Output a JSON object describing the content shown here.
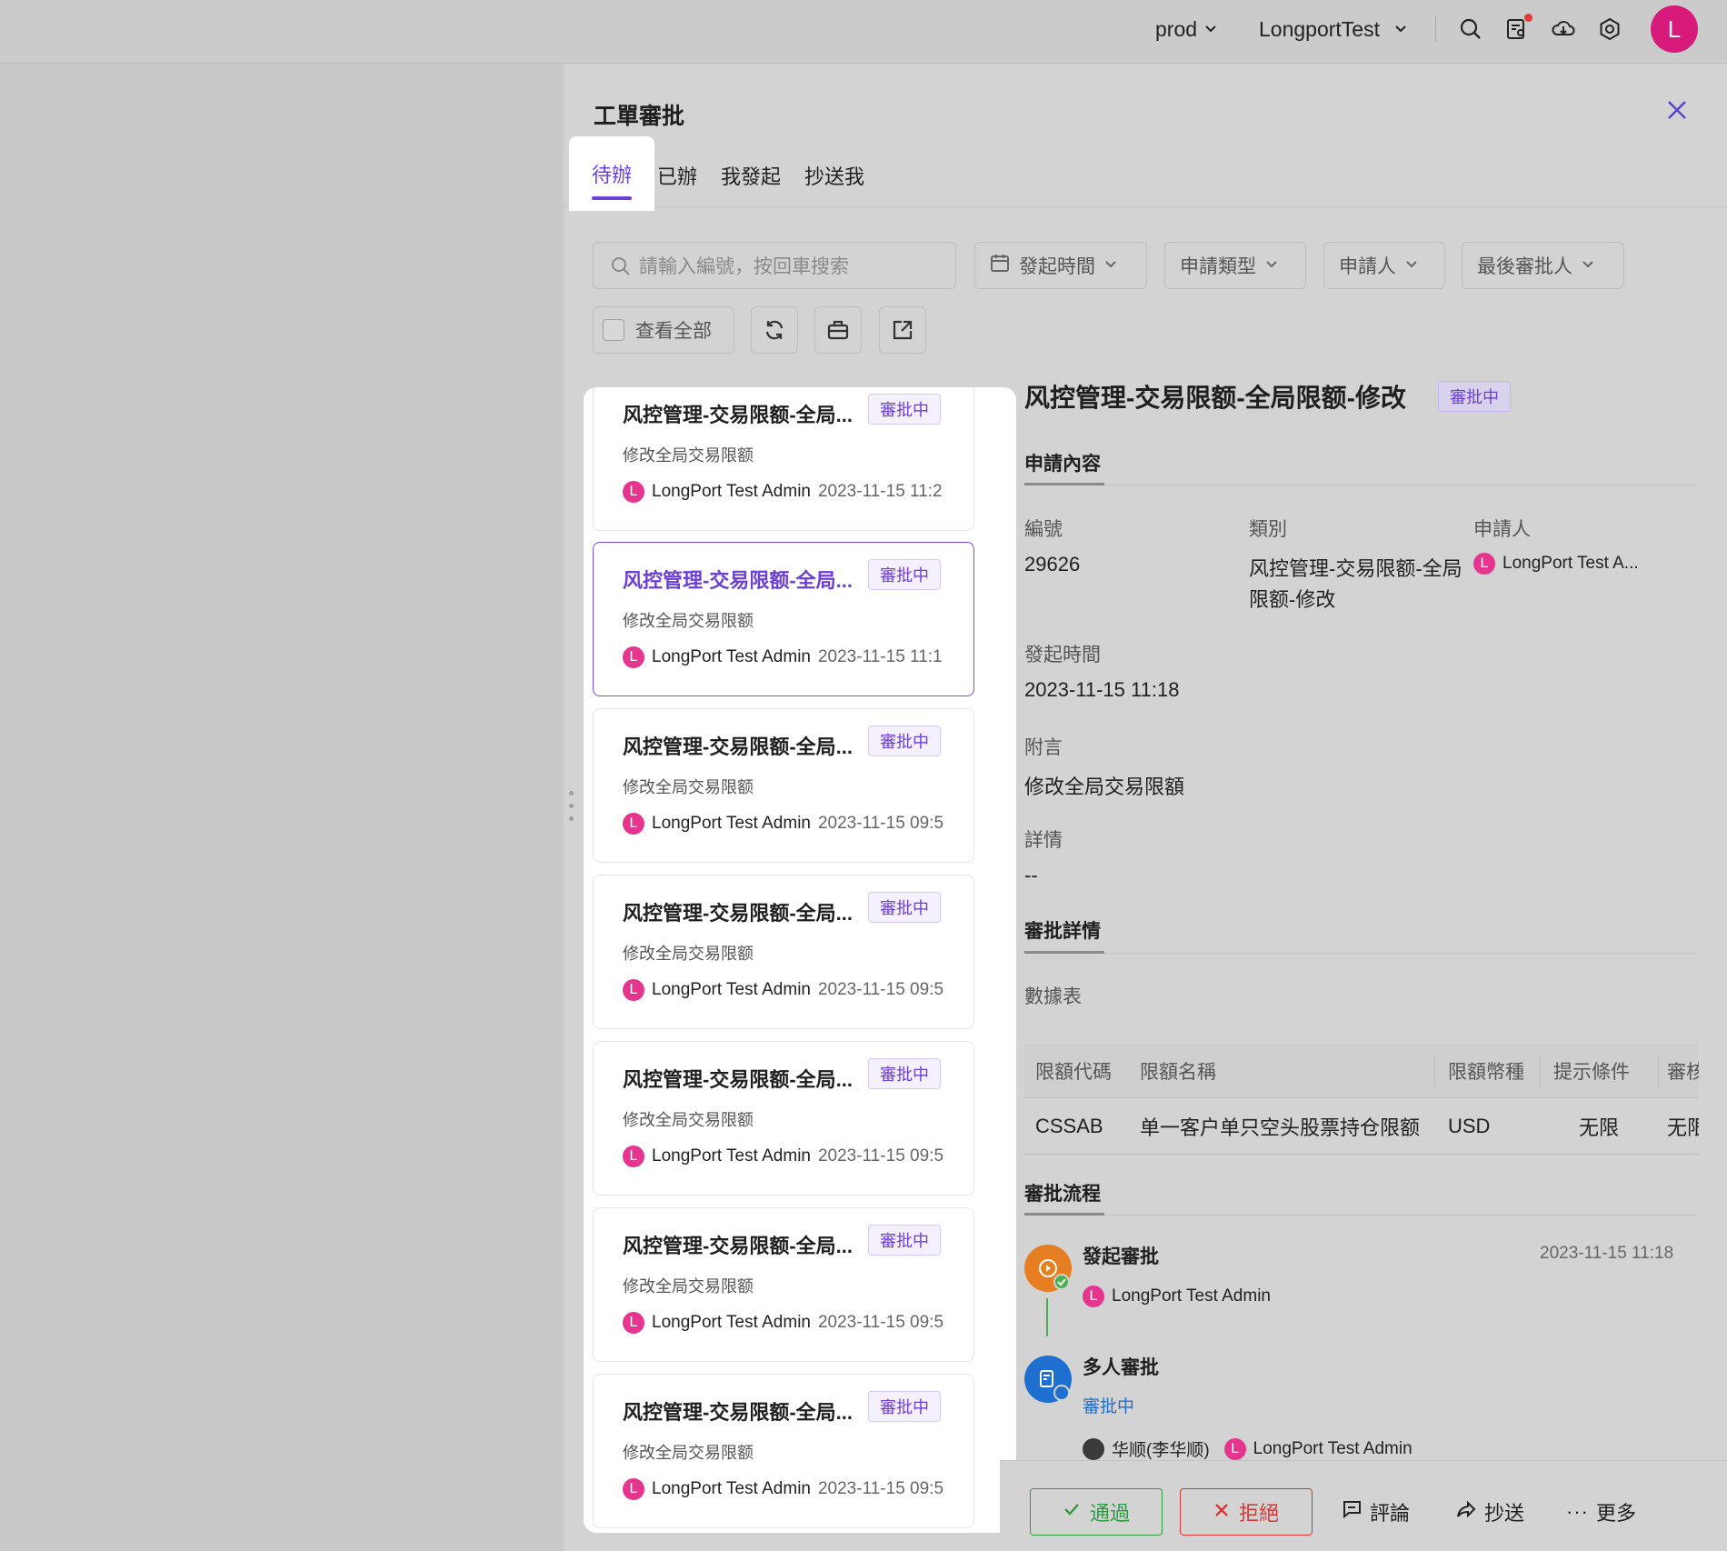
{
  "topbar": {
    "env": "prod",
    "org": "LongportTest",
    "avatar_letter": "L",
    "icons": [
      "search-icon",
      "approval-doc-icon",
      "download-icon",
      "settings-icon"
    ]
  },
  "drawer": {
    "title": "工單審批",
    "tabs": [
      {
        "label": "待辦",
        "active": true
      },
      {
        "label": "已辦",
        "active": false
      },
      {
        "label": "我發起",
        "active": false
      },
      {
        "label": "抄送我",
        "active": false
      }
    ],
    "search_placeholder": "請輸入編號，按回車搜索",
    "filters": {
      "start_time": "發起時間",
      "type": "申請類型",
      "applicant": "申請人",
      "last_approver": "最後審批人"
    },
    "view_all": "查看全部"
  },
  "list": [
    {
      "title": "风控管理-交易限额-全局...",
      "badge": "審批中",
      "subtitle": "修改全局交易限额",
      "avatar": "L",
      "user": "LongPort Test Admin",
      "time": "2023-11-15 11:2",
      "selected": false
    },
    {
      "title": "风控管理-交易限额-全局...",
      "badge": "審批中",
      "subtitle": "修改全局交易限额",
      "avatar": "L",
      "user": "LongPort Test Admin",
      "time": "2023-11-15 11:1",
      "selected": true
    },
    {
      "title": "风控管理-交易限额-全局...",
      "badge": "審批中",
      "subtitle": "修改全局交易限额",
      "avatar": "L",
      "user": "LongPort Test Admin",
      "time": "2023-11-15 09:5",
      "selected": false
    },
    {
      "title": "风控管理-交易限额-全局...",
      "badge": "審批中",
      "subtitle": "修改全局交易限额",
      "avatar": "L",
      "user": "LongPort Test Admin",
      "time": "2023-11-15 09:5",
      "selected": false
    },
    {
      "title": "风控管理-交易限额-全局...",
      "badge": "審批中",
      "subtitle": "修改全局交易限额",
      "avatar": "L",
      "user": "LongPort Test Admin",
      "time": "2023-11-15 09:5",
      "selected": false
    },
    {
      "title": "风控管理-交易限额-全局...",
      "badge": "審批中",
      "subtitle": "修改全局交易限额",
      "avatar": "L",
      "user": "LongPort Test Admin",
      "time": "2023-11-15 09:5",
      "selected": false
    },
    {
      "title": "风控管理-交易限额-全局...",
      "badge": "審批中",
      "subtitle": "修改全局交易限额",
      "avatar": "L",
      "user": "LongPort Test Admin",
      "time": "2023-11-15 09:5",
      "selected": false
    }
  ],
  "detail": {
    "title": "风控管理-交易限额-全局限额-修改",
    "badge": "審批中",
    "section_content": "申請內容",
    "id_label": "編號",
    "id_value": "29626",
    "category_label": "類別",
    "category_value_line1": "风控管理-交易限额-全局",
    "category_value_line2": "限额-修改",
    "applicant_label": "申請人",
    "applicant_avatar": "L",
    "applicant_value": "LongPort Test A...",
    "start_time_label": "發起時間",
    "start_time_value": "2023-11-15 11:18",
    "note_label": "附言",
    "note_value": "修改全局交易限額",
    "details_label": "詳情",
    "details_value": "--",
    "section_approval_details": "審批詳情",
    "datasheet_label": "數據表",
    "table": {
      "headers": [
        "限額代碼",
        "限額名稱",
        "限額幣種",
        "提示條件",
        "審核"
      ],
      "rows": [
        [
          "CSSAB",
          "单一客户单只空头股票持仓限额",
          "USD",
          "无限",
          "无限"
        ]
      ]
    },
    "section_flow": "審批流程",
    "flow": [
      {
        "title": "發起審批",
        "time": "2023-11-15 11:18",
        "avatar": "L",
        "user": "LongPort Test Admin"
      },
      {
        "title": "多人審批",
        "status": "審批中",
        "user1": "华顺(李华顺)",
        "avatar2": "L",
        "user2": "LongPort Test Admin"
      }
    ]
  },
  "footer": {
    "approve": "通過",
    "reject": "拒絕",
    "comment": "評論",
    "cc": "抄送",
    "more": "更多"
  },
  "colors": {
    "accent": "#6c3fd6",
    "approve": "#2e9b3f",
    "reject": "#d93636",
    "avatar": "#d81b7b",
    "status_blue": "#1e6fd0"
  }
}
